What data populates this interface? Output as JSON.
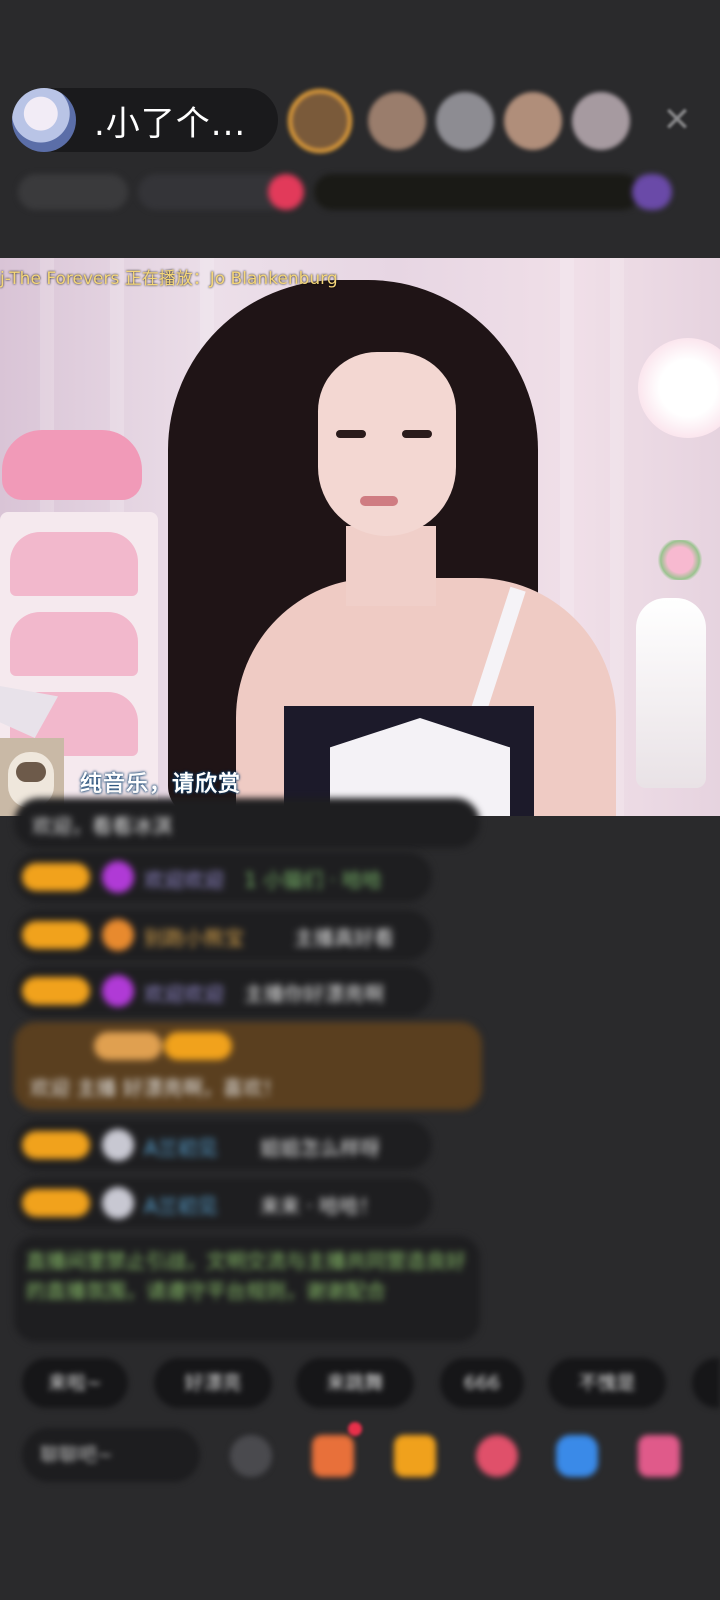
{
  "header": {
    "host_name": ".小了个...",
    "viewer_colors": [
      "#7a5a3a",
      "#9a7d6c",
      "#8d8c92",
      "#b08e7a",
      "#a69aa0"
    ],
    "close_icon": "close-icon"
  },
  "video": {
    "now_playing": "j-The Forevers  正在播放：Jo Blankenburg",
    "subtitle": "纯音乐，请欣赏"
  },
  "chat": {
    "messages": [
      {
        "kind": "plain",
        "text": "欢迎，看看冰淇"
      },
      {
        "kind": "badge",
        "icon": "gem-icon",
        "icon_color": "#b03ad6",
        "name": "欢迎欢迎",
        "name_color": "#9a8fd6",
        "text": "1 小猫们  ·  哈哈"
      },
      {
        "kind": "badge",
        "icon": "hand-icon",
        "icon_color": "#e88a2e",
        "name": "别跑小熊宝",
        "name_color": "#d8a34a",
        "text": "主播真好看"
      },
      {
        "kind": "badge",
        "icon": "gem-icon",
        "icon_color": "#b03ad6",
        "name": "欢迎欢迎",
        "name_color": "#9a8fd6",
        "text": "主播你好漂亮啊"
      },
      {
        "kind": "highlight",
        "text": "欢迎 主播 好漂亮啊，喜欢！"
      },
      {
        "kind": "badge",
        "icon": "cloud-icon",
        "icon_color": "#c8c8d2",
        "name": "A兰初见",
        "name_color": "#5aa6d6",
        "text": "姐姐怎么样呀"
      },
      {
        "kind": "badge",
        "icon": "cloud-icon",
        "icon_color": "#c8c8d2",
        "name": "A兰初见",
        "name_color": "#5aa6d6",
        "text": "来来  · 哈哈！"
      },
      {
        "kind": "system",
        "text": "直播间里禁止引战，文明交流与主播共同营造良好的直播氛围，请遵守平台规则，谢谢配合"
      }
    ]
  },
  "quick_actions": [
    "来啦~",
    "好漂亮",
    "来跳舞",
    "666",
    "不愧是"
  ],
  "input": {
    "placeholder": "聊聊吧~"
  },
  "tools": [
    {
      "name": "emoji-icon",
      "color": "#4a4a4e"
    },
    {
      "name": "gift-box-icon",
      "color": "#e8703a"
    },
    {
      "name": "treasure-icon",
      "color": "#f0a11c"
    },
    {
      "name": "heart-icon",
      "color": "#e0506a"
    },
    {
      "name": "game-icon",
      "color": "#3a8ae8"
    },
    {
      "name": "grid-icon",
      "color": "#e05a8a"
    }
  ]
}
